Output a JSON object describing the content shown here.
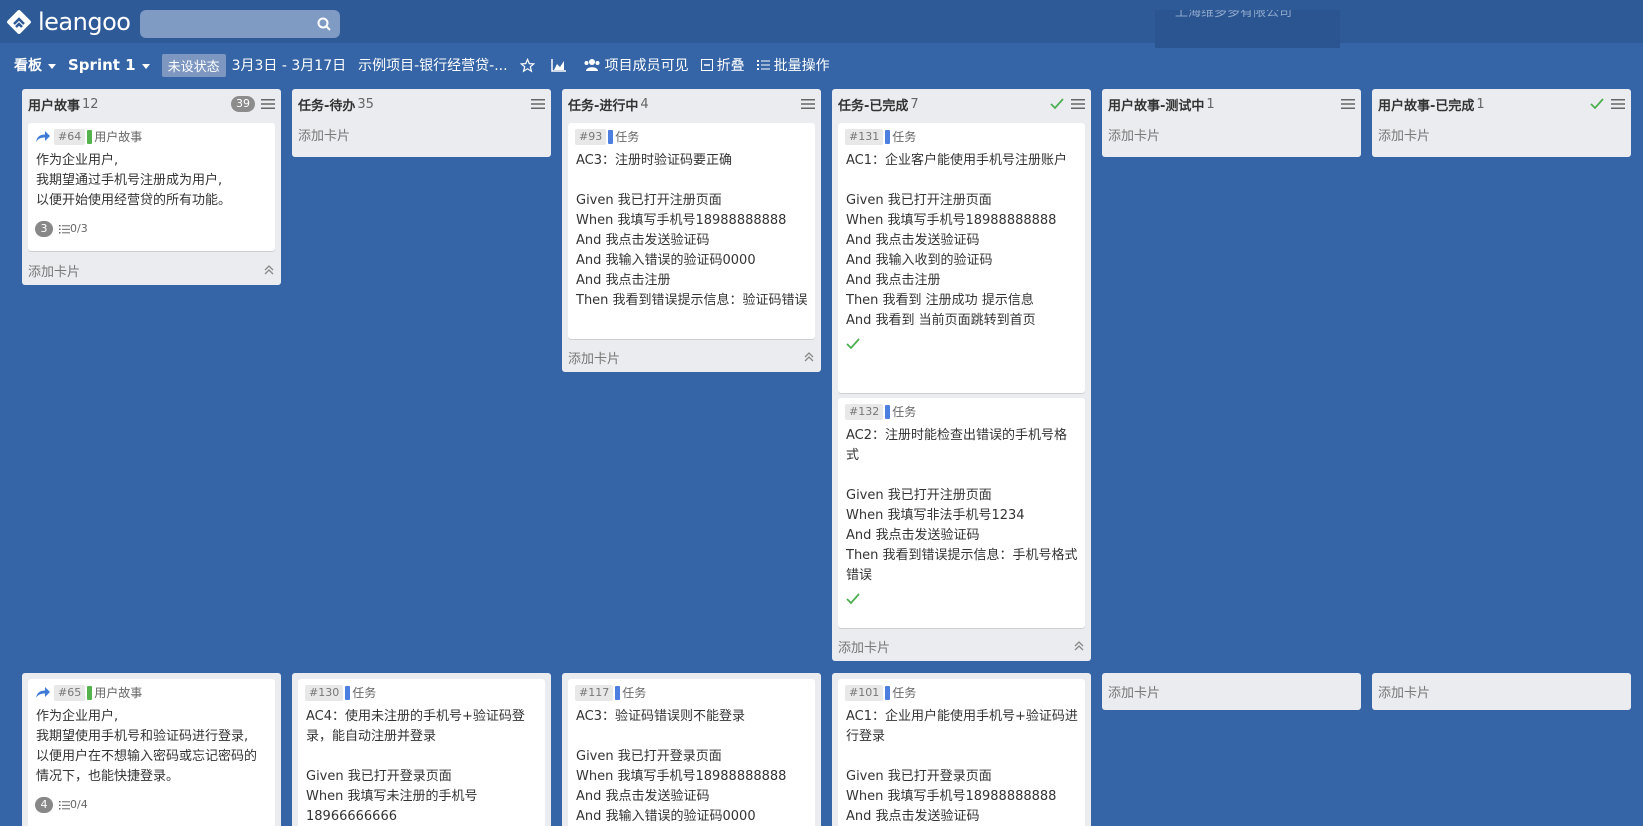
{
  "app": {
    "logo": "leangoo",
    "company": "上海维多多有限公司"
  },
  "toolbar": {
    "board": "看板",
    "sprint": "Sprint 1",
    "status": "未设状态",
    "dates": "3月3日 - 3月17日",
    "project": "示例项目-银行经营贷-...",
    "members": "项目成员可见",
    "collapse": "折叠",
    "batch": "批量操作"
  },
  "columns": [
    {
      "title": "用户故事",
      "count": "12",
      "badge": "39"
    },
    {
      "title": "任务-待办",
      "count": "35"
    },
    {
      "title": "任务-进行中",
      "count": "4"
    },
    {
      "title": "任务-已完成",
      "count": "7"
    },
    {
      "title": "用户故事-测试中",
      "count": "1"
    },
    {
      "title": "用户故事-已完成",
      "count": "1"
    }
  ],
  "add_card": "添加卡片",
  "cards": {
    "c64": {
      "id": "#64",
      "type": "用户故事",
      "body": "作为企业用户,\n我期望通过手机号注册成为用户,\n以便开始使用经营贷的所有功能。",
      "count": "3",
      "checklist": "0/3"
    },
    "c93": {
      "id": "#93",
      "type": "任务",
      "body": "AC3：注册时验证码要正确\n\nGiven 我已打开注册页面\nWhen 我填写手机号18988888888\nAnd 我点击发送验证码\nAnd 我输入错误的验证码0000\nAnd 我点击注册\nThen 我看到错误提示信息：验证码错误"
    },
    "c131": {
      "id": "#131",
      "type": "任务",
      "body": "AC1：企业客户能使用手机号注册账户\n\nGiven 我已打开注册页面\nWhen 我填写手机号18988888888\nAnd 我点击发送验证码\nAnd 我输入收到的验证码\nAnd 我点击注册\nThen 我看到 注册成功 提示信息\nAnd 我看到 当前页面跳转到首页"
    },
    "c132": {
      "id": "#132",
      "type": "任务",
      "body": "AC2：注册时能检查出错误的手机号格式\n\nGiven 我已打开注册页面\nWhen 我填写非法手机号1234\nAnd 我点击发送验证码\nThen 我看到错误提示信息：手机号格式错误"
    },
    "c65": {
      "id": "#65",
      "type": "用户故事",
      "body": "作为企业用户,\n我期望使用手机号和验证码进行登录,\n以便用户在不想输入密码或忘记密码的情况下，也能快捷登录。",
      "count": "4",
      "checklist": "0/4"
    },
    "c130": {
      "id": "#130",
      "type": "任务",
      "body": "AC4：使用未注册的手机号+验证码登录，能自动注册并登录\n\nGiven 我已打开登录页面\nWhen 我填写未注册的手机号18966666666"
    },
    "c117": {
      "id": "#117",
      "type": "任务",
      "body": "AC3：验证码错误则不能登录\n\nGiven 我已打开登录页面\nWhen 我填写手机号18988888888\nAnd 我点击发送验证码\nAnd 我输入错误的验证码0000"
    },
    "c101": {
      "id": "#101",
      "type": "任务",
      "body": "AC1：企业用户能使用手机号+验证码进行登录\n\nGiven 我已打开登录页面\nWhen 我填写手机号18988888888\nAnd 我点击发送验证码"
    }
  },
  "colors": {
    "background": "#3565a6",
    "topbar": "#2e5a97",
    "story": "#55b34e",
    "task": "#4d7fe0",
    "done": "#4caf50"
  }
}
